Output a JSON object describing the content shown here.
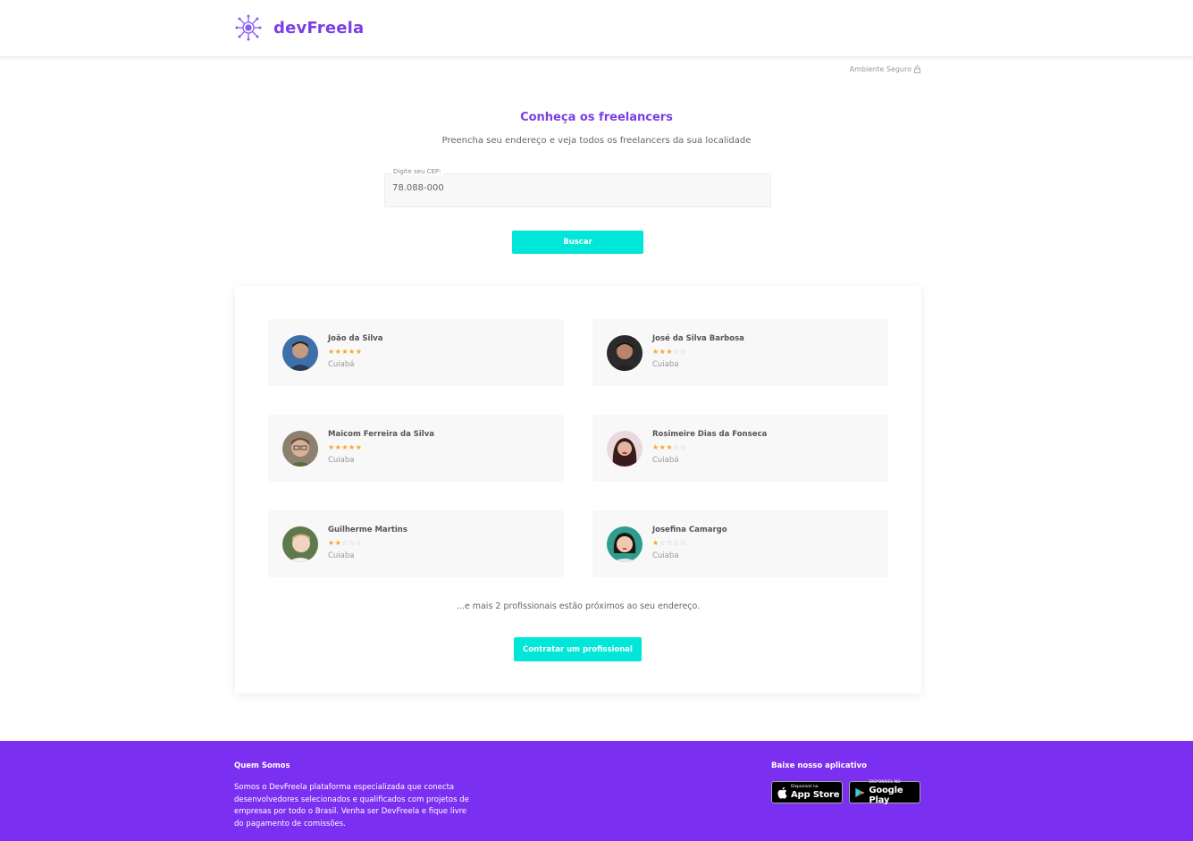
{
  "header": {
    "brand": "devFreela",
    "brand_color": "#7b3fe4",
    "logo_icon": "gear-circuit-logo"
  },
  "secure": {
    "label": "Ambiente Seguro",
    "icon": "lock-icon"
  },
  "main": {
    "title": "Conheça os freelancers",
    "subtitle": "Preencha seu endereço e veja todos os freelancers da sua localidade",
    "cep_label": "Digite seu CEP:",
    "cep_value": "78.088-000",
    "search_button": "Buscar",
    "accent_color": "#00e6d8"
  },
  "freelancers": [
    {
      "name": "João da Silva",
      "rating": 5,
      "city": "Cuiabá"
    },
    {
      "name": "José da Silva Barbosa",
      "rating": 3,
      "city": "Cuiaba"
    },
    {
      "name": "Maicom Ferreira da Silva",
      "rating": 5,
      "city": "Cuiaba"
    },
    {
      "name": "Rosimeire Dias da Fonseca",
      "rating": 3,
      "city": "Cuiabá"
    },
    {
      "name": "Guilherme Martins",
      "rating": 2,
      "city": "Cuiaba"
    },
    {
      "name": "Josefina Camargo",
      "rating": 1,
      "city": "Cuiaba"
    }
  ],
  "more_text": "...e mais 2 profissionais estão próximos ao seu endereço.",
  "hire_button": "Contratar um profissional",
  "footer": {
    "background": "#7b2ff0",
    "about_title": "Quem Somos",
    "about_text": "Somos o DevFreela plataforma especializada que conecta desenvolvedores selecionados e qualificados com projetos de empresas por todo o Brasil. Venha ser DevFreela e fique livre do pagamento de comissões.",
    "app_title": "Baixe nosso aplicativo",
    "app_store_small": "Disponível na",
    "app_store_big": "App Store",
    "google_play_small": "DISPONÍVEL NO",
    "google_play_big": "Google Play"
  }
}
